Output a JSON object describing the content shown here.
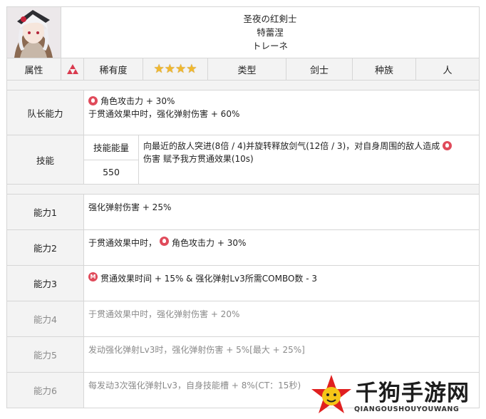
{
  "character": {
    "name_line1": "圣夜の红剣士",
    "name_line2": "特蕾涅",
    "name_line3": "トレーネ"
  },
  "attributes": {
    "attr_label": "属性",
    "rarity_label": "稀有度",
    "rarity_stars": 4,
    "type_label": "类型",
    "type_value": "剑士",
    "race_label": "种族",
    "race_value": "人"
  },
  "leader": {
    "label": "队长能力",
    "line1": "角色攻击力 + 30%",
    "line2": "于贯通效果中时，强化弹射伤害 + 60%"
  },
  "skill": {
    "label": "技能",
    "energy_label": "技能能量",
    "energy_value": "550",
    "text1": "向最近的敌人突进(8倍 / 4)并旋转释放剑气(12倍 / 3)，对自身周围的敌人造成",
    "text2": "伤害 赋予我方贯通效果(10s)"
  },
  "abilities": [
    {
      "label": "能力1",
      "text": "强化弹射伤害 + 25%"
    },
    {
      "label": "能力2",
      "prefix": "于贯通效果中时，",
      "text": "角色攻击力 + 30%"
    },
    {
      "label": "能力3",
      "text": "贯通效果时间 + 15% & 强化弹射Lv3所需COMBO数 - 3"
    },
    {
      "label": "能力4",
      "text": "于贯通效果中时，强化弹射伤害 + 20%"
    },
    {
      "label": "能力5",
      "text": "发动强化弹射Lv3时，强化弹射伤害 + 5%[最大 + 25%]"
    },
    {
      "label": "能力6",
      "text": "每发动3次强化弹射Lv3，自身技能槽 + 8%(CT：15秒)"
    }
  ],
  "watermark": {
    "title": "千狗手游网",
    "subtitle": "QIANGOUSHOUYOUWANG"
  },
  "colors": {
    "fire": "#e04b5b",
    "star": "#f1b82d",
    "border": "#d6d6d6",
    "label_bg": "#f3f3f3"
  }
}
